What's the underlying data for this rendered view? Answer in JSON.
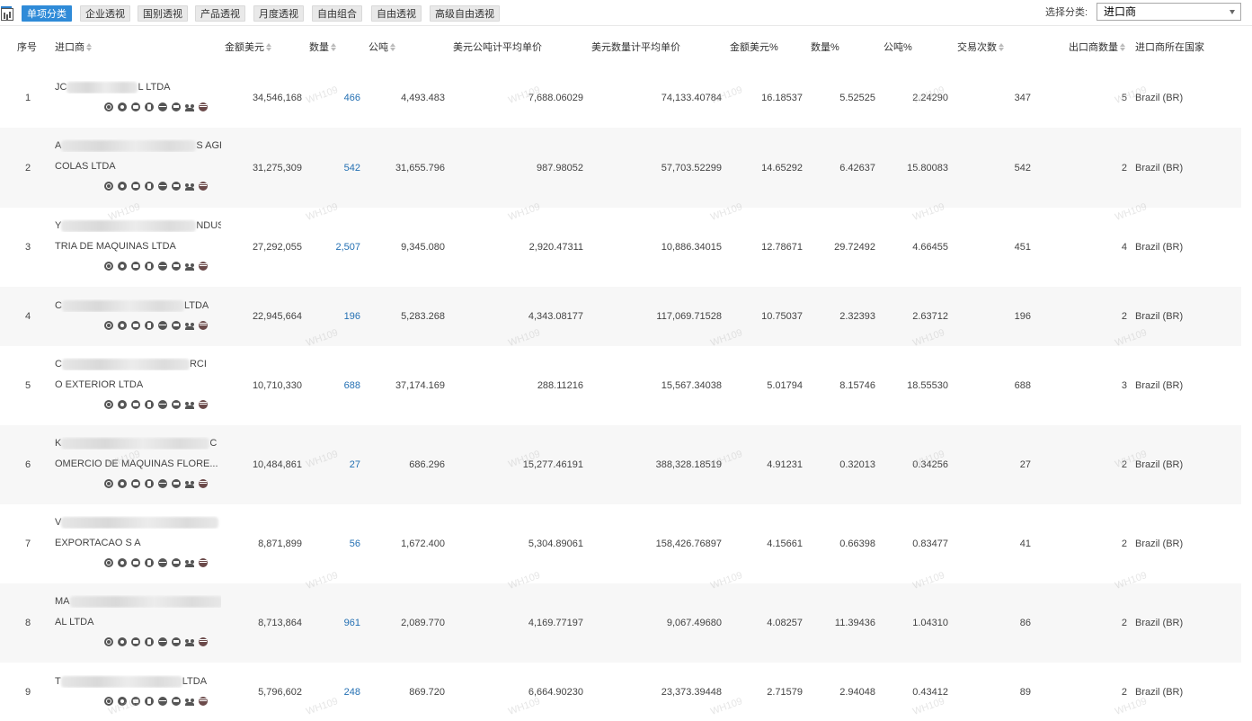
{
  "toolbar": {
    "tabs": [
      {
        "label": "单项分类",
        "active": true
      },
      {
        "label": "企业透视",
        "active": false
      },
      {
        "label": "国别透视",
        "active": false
      },
      {
        "label": "产品透视",
        "active": false
      },
      {
        "label": "月度透视",
        "active": false
      },
      {
        "label": "自由组合",
        "active": false
      },
      {
        "label": "自由透视",
        "active": false
      },
      {
        "label": "高级自由透视",
        "active": false
      }
    ],
    "category_label": "选择分类:",
    "category_value": "进口商"
  },
  "table": {
    "headers": {
      "index": "序号",
      "importer": "进口商",
      "amount_usd": "金额美元",
      "quantity": "数量",
      "tonnage": "公吨",
      "usd_per_ton": "美元公吨计平均单价",
      "usd_per_qty": "美元数量计平均单价",
      "amount_pct": "金额美元%",
      "quantity_pct": "数量%",
      "tonnage_pct": "公吨%",
      "transactions": "交易次数",
      "exporter_count": "出口商数量",
      "country": "进口商所在国家"
    },
    "rows": [
      {
        "index": "1",
        "name1_pre": "JC",
        "name1_post": "L LTDA",
        "name2": "",
        "amount_usd": "34,546,168",
        "quantity": "466",
        "tonnage": "4,493.483",
        "usd_per_ton": "7,688.06029",
        "usd_per_qty": "74,133.40784",
        "amount_pct": "16.18537",
        "quantity_pct": "5.52525",
        "tonnage_pct": "2.24290",
        "transactions": "347",
        "exporter_count": "5",
        "country": "Brazil (BR)"
      },
      {
        "index": "2",
        "name1_pre": "A",
        "name1_post": "S AGRI",
        "name2": "COLAS LTDA",
        "amount_usd": "31,275,309",
        "quantity": "542",
        "tonnage": "31,655.796",
        "usd_per_ton": "987.98052",
        "usd_per_qty": "57,703.52299",
        "amount_pct": "14.65292",
        "quantity_pct": "6.42637",
        "tonnage_pct": "15.80083",
        "transactions": "542",
        "exporter_count": "2",
        "country": "Brazil (BR)"
      },
      {
        "index": "3",
        "name1_pre": "Y",
        "name1_post": "NDUS",
        "name2": "TRIA DE MAQUINAS LTDA",
        "amount_usd": "27,292,055",
        "quantity": "2,507",
        "tonnage": "9,345.080",
        "usd_per_ton": "2,920.47311",
        "usd_per_qty": "10,886.34015",
        "amount_pct": "12.78671",
        "quantity_pct": "29.72492",
        "tonnage_pct": "4.66455",
        "transactions": "451",
        "exporter_count": "4",
        "country": "Brazil (BR)"
      },
      {
        "index": "4",
        "name1_pre": "C",
        "name1_post": "LTDA",
        "name2": "",
        "amount_usd": "22,945,664",
        "quantity": "196",
        "tonnage": "5,283.268",
        "usd_per_ton": "4,343.08177",
        "usd_per_qty": "117,069.71528",
        "amount_pct": "10.75037",
        "quantity_pct": "2.32393",
        "tonnage_pct": "2.63712",
        "transactions": "196",
        "exporter_count": "2",
        "country": "Brazil (BR)"
      },
      {
        "index": "5",
        "name1_pre": "C",
        "name1_post": "RCI",
        "name2": "O EXTERIOR LTDA",
        "amount_usd": "10,710,330",
        "quantity": "688",
        "tonnage": "37,174.169",
        "usd_per_ton": "288.11216",
        "usd_per_qty": "15,567.34038",
        "amount_pct": "5.01794",
        "quantity_pct": "8.15746",
        "tonnage_pct": "18.55530",
        "transactions": "688",
        "exporter_count": "3",
        "country": "Brazil (BR)"
      },
      {
        "index": "6",
        "name1_pre": "K",
        "name1_post": "C",
        "name2": "OMERCIO DE MAQUINAS FLORE...",
        "amount_usd": "10,484,861",
        "quantity": "27",
        "tonnage": "686.296",
        "usd_per_ton": "15,277.46191",
        "usd_per_qty": "388,328.18519",
        "amount_pct": "4.91231",
        "quantity_pct": "0.32013",
        "tonnage_pct": "0.34256",
        "transactions": "27",
        "exporter_count": "2",
        "country": "Brazil (BR)"
      },
      {
        "index": "7",
        "name1_pre": "V",
        "name1_post": "",
        "name2": "EXPORTACAO S A",
        "amount_usd": "8,871,899",
        "quantity": "56",
        "tonnage": "1,672.400",
        "usd_per_ton": "5,304.89061",
        "usd_per_qty": "158,426.76897",
        "amount_pct": "4.15661",
        "quantity_pct": "0.66398",
        "tonnage_pct": "0.83477",
        "transactions": "41",
        "exporter_count": "2",
        "country": "Brazil (BR)"
      },
      {
        "index": "8",
        "name1_pre": "MA",
        "name1_post": "I",
        "name2": "AL LTDA",
        "amount_usd": "8,713,864",
        "quantity": "961",
        "tonnage": "2,089.770",
        "usd_per_ton": "4,169.77197",
        "usd_per_qty": "9,067.49680",
        "amount_pct": "4.08257",
        "quantity_pct": "11.39436",
        "tonnage_pct": "1.04310",
        "transactions": "86",
        "exporter_count": "2",
        "country": "Brazil (BR)"
      },
      {
        "index": "9",
        "name1_pre": "T",
        "name1_post": "LTDA",
        "name2": "",
        "amount_usd": "5,796,602",
        "quantity": "248",
        "tonnage": "869.720",
        "usd_per_ton": "6,664.90230",
        "usd_per_qty": "23,373.39448",
        "amount_pct": "2.71579",
        "quantity_pct": "2.94048",
        "tonnage_pct": "0.43412",
        "transactions": "89",
        "exporter_count": "2",
        "country": "Brazil (BR)"
      }
    ],
    "row_icons": [
      "target-icon",
      "settings-icon",
      "bi-icon",
      "lock-icon",
      "globe-icon",
      "ai-icon",
      "users-icon",
      "world-icon"
    ]
  },
  "watermark": "WH109",
  "colors": {
    "accent": "#2f8bd8",
    "link": "#2470b3",
    "row_alt": "#f7f7f7"
  }
}
